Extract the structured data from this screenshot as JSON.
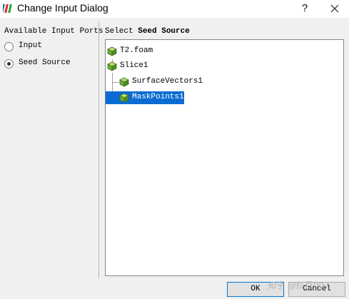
{
  "window": {
    "title": "Change Input Dialog",
    "help_glyph": "?",
    "app_icon": "paraview-icon",
    "close_icon": "close-icon"
  },
  "left": {
    "heading": "Available Input Ports",
    "ports": [
      {
        "label": "Input",
        "checked": false
      },
      {
        "label": "Seed Source",
        "checked": true
      }
    ]
  },
  "right": {
    "heading_prefix": "Select",
    "heading_strong": "Seed Source"
  },
  "tree": {
    "items": [
      {
        "label": "T2.foam",
        "depth": 0,
        "selected": false
      },
      {
        "label": "Slice1",
        "depth": 0,
        "selected": false
      },
      {
        "label": "SurfaceVectors1",
        "depth": 1,
        "selected": false
      },
      {
        "label": "MaskPoints1",
        "depth": 1,
        "selected": true
      }
    ],
    "item_icon": "pipeline-source-cube-icon",
    "selection_color": "#0a6cd2"
  },
  "buttons": {
    "ok": "OK",
    "cancel": "Cancel"
  },
  "watermark": "知乎 @红豆007"
}
